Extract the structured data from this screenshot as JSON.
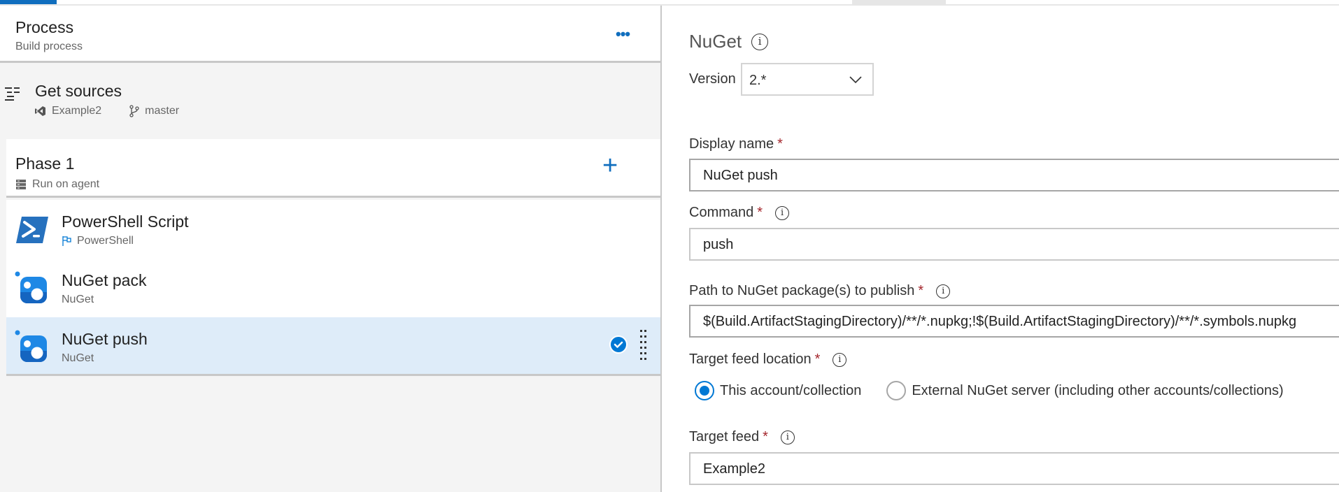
{
  "left": {
    "header": {
      "title": "Process",
      "subtitle": "Build process",
      "more_label": "•••"
    },
    "get_sources": {
      "title": "Get sources",
      "repo": "Example2",
      "branch": "master"
    },
    "phase": {
      "title": "Phase 1",
      "subtitle": "Run on agent",
      "add_label": "+"
    },
    "tasks": [
      {
        "title": "PowerShell Script",
        "subtitle": "PowerShell",
        "icon": "powershell-icon",
        "selected": false
      },
      {
        "title": "NuGet pack",
        "subtitle": "NuGet",
        "icon": "nuget-icon",
        "selected": false
      },
      {
        "title": "NuGet push",
        "subtitle": "NuGet",
        "icon": "nuget-icon",
        "selected": true
      }
    ]
  },
  "right": {
    "title": "NuGet",
    "version": {
      "label": "Version",
      "value": "2.*"
    },
    "fields": {
      "display_name": {
        "label": "Display name",
        "required": "*",
        "value": "NuGet push"
      },
      "command": {
        "label": "Command",
        "required": "*",
        "value": "push"
      },
      "path": {
        "label": "Path to NuGet package(s) to publish",
        "required": "*",
        "value": "$(Build.ArtifactStagingDirectory)/**/*.nupkg;!$(Build.ArtifactStagingDirectory)/**/*.symbols.nupkg"
      },
      "target_location": {
        "label": "Target feed location",
        "required": "*",
        "options": [
          "This account/collection",
          "External NuGet server (including other accounts/collections)"
        ],
        "selected": "This account/collection"
      },
      "target_feed": {
        "label": "Target feed",
        "required": "*",
        "value": "Example2"
      }
    },
    "info_glyph": "i"
  },
  "colors": {
    "accent": "#0078d4",
    "selected_row": "#deecf9",
    "required": "#a4262c"
  }
}
